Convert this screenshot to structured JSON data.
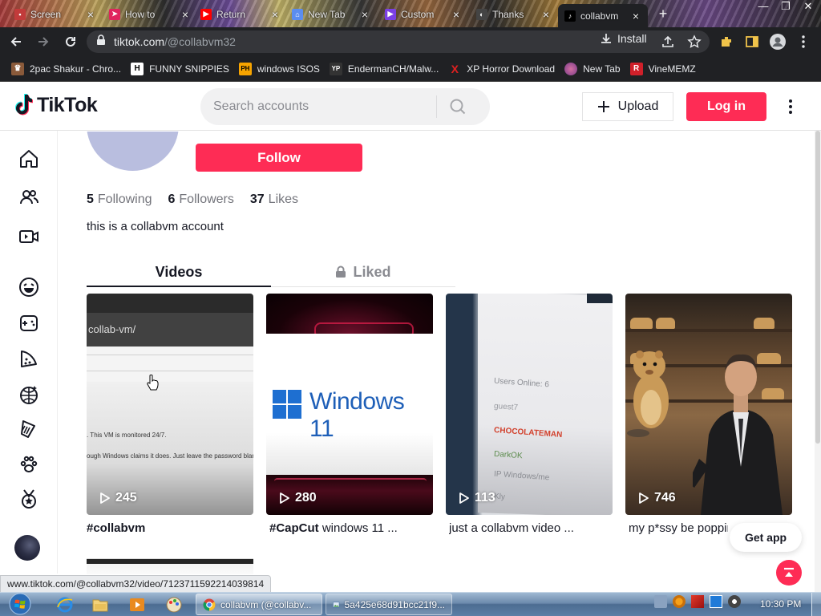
{
  "browser": {
    "tabs": [
      {
        "label": "Screen",
        "icon": "tab-favicon-image",
        "color": "#c23b3b"
      },
      {
        "label": "How to",
        "icon": "tab-favicon-arrow",
        "color": "#e0245e"
      },
      {
        "label": "Return",
        "icon": "tab-favicon-youtube",
        "color": "#ff0000"
      },
      {
        "label": "New Tab",
        "icon": "tab-favicon-bank",
        "color": "#5b8def"
      },
      {
        "label": "Custom",
        "icon": "tab-favicon-play",
        "color": "#7b3fe4"
      },
      {
        "label": "Thanks",
        "icon": "tab-favicon-glasses",
        "color": "#444444"
      },
      {
        "label": "collabvm",
        "icon": "tab-favicon-tiktok",
        "color": "#000000"
      }
    ],
    "url_domain": "tiktok.com",
    "url_path": "/@collabvm32",
    "install_label": "Install",
    "bookmarks": [
      {
        "label": "2pac Shakur - Chro...",
        "icon": "bookmark-icon-2pac",
        "badge": "",
        "color": "#8a5a3a"
      },
      {
        "label": "FUNNY SNIPPIES",
        "icon": "bookmark-icon-h",
        "badge": "H",
        "color": "#ffffff"
      },
      {
        "label": "windows ISOS",
        "icon": "bookmark-icon-ph",
        "badge": "PH",
        "color": "#f7a400"
      },
      {
        "label": "EndermanCH/Malw...",
        "icon": "bookmark-icon-yp",
        "badge": "YP",
        "color": "#333333"
      },
      {
        "label": "XP Horror Download",
        "icon": "bookmark-icon-x",
        "badge": "X",
        "color": "#e02020"
      },
      {
        "label": "New Tab",
        "icon": "bookmark-icon-newtab",
        "badge": "",
        "color": "#d36fa0"
      },
      {
        "label": "VineMEMZ",
        "icon": "bookmark-icon-r",
        "badge": "R",
        "color": "#d0202a"
      }
    ]
  },
  "tiktok": {
    "logo_text": "TikTok",
    "search_placeholder": "Search accounts",
    "upload_label": "Upload",
    "login_label": "Log in",
    "follow_label": "Follow",
    "stats": {
      "following_count": "5",
      "following_label": "Following",
      "followers_count": "6",
      "followers_label": "Followers",
      "likes_count": "37",
      "likes_label": "Likes"
    },
    "bio": "this is a collabvm account",
    "tab_videos": "Videos",
    "tab_liked": "Liked",
    "videos": [
      {
        "views": "245",
        "caption_tag": "#collabvm",
        "caption_text": ""
      },
      {
        "views": "280",
        "caption_tag": "#CapCut",
        "caption_text": " windows 11 ..."
      },
      {
        "views": "113",
        "caption_tag": "",
        "caption_text": "just a collabvm video ..."
      },
      {
        "views": "746",
        "caption_tag": "",
        "caption_text": "my p*ssy be poppin..."
      }
    ],
    "video1_bar_text": "collab-vm/",
    "video1_line1": ". This VM is monitored 24/7.",
    "video1_line2": "ough Windows claims it does. Just leave the password blank to log",
    "video2_text": "Windows 11",
    "video3_users": [
      "Users Online: 6",
      "guest7",
      "CHOCOLATEMAN",
      "DarkOK",
      "IP Windows/me",
      "Kly"
    ],
    "get_app_label": "Get app",
    "accent_color": "#fe2c55"
  },
  "status_url": "www.tiktok.com/@collabvm32/video/7123711592214039814",
  "taskbar": {
    "tasks": [
      {
        "label": "collabvm (@collabv...",
        "icon": "chrome-icon"
      },
      {
        "label": "5a425e68d91bcc21f9...",
        "icon": "image-viewer-icon"
      }
    ],
    "clock": "10:30 PM"
  }
}
